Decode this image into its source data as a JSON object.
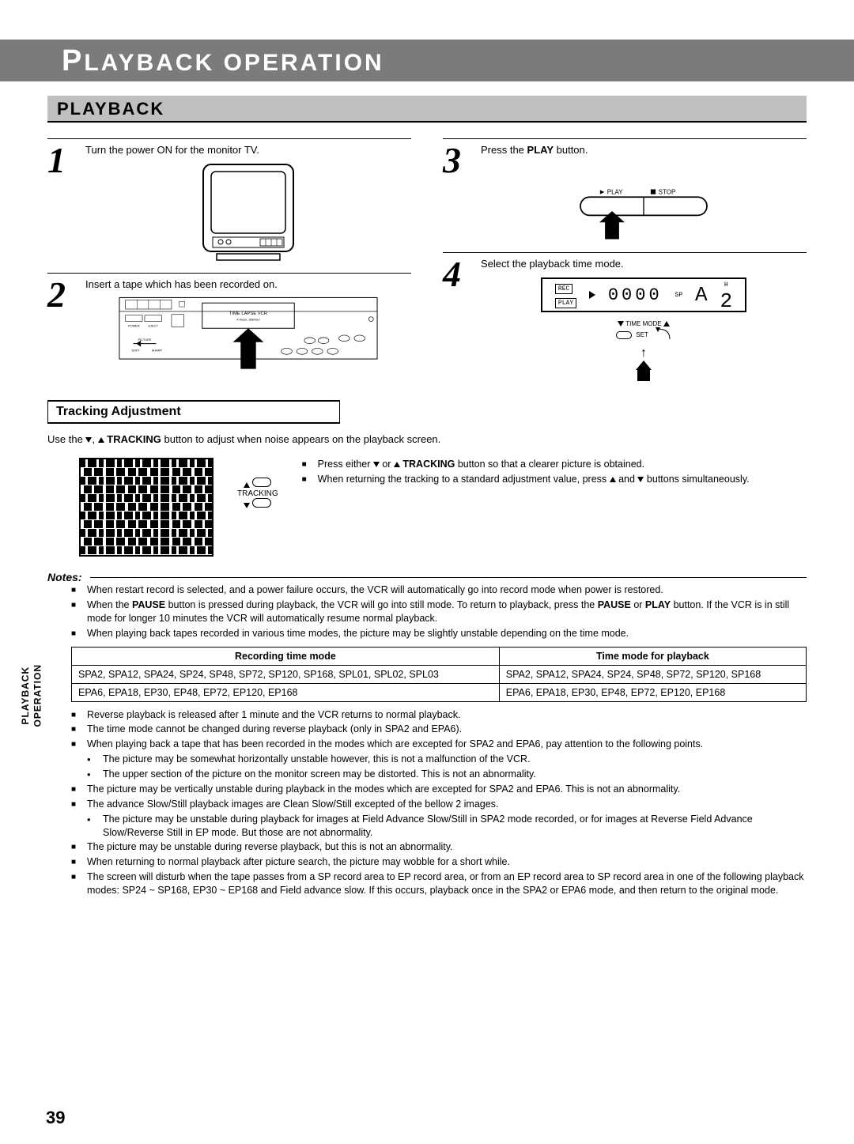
{
  "chapter_title": "LAYBACK OPERATION",
  "chapter_initial": "P",
  "section_title": "PLAYBACK",
  "side_tab_line1": "PLAYBACK",
  "side_tab_line2": "OPERATION",
  "page_number": "39",
  "steps": {
    "s1": "Turn the power ON for the monitor TV.",
    "s2": "Insert a tape which has been recorded on.",
    "s3_pre": "Press the ",
    "s3_bold": "PLAY",
    "s3_post": " button.",
    "s4": "Select the playback time mode."
  },
  "diagrams": {
    "play_label": "PLAY",
    "stop_label": "STOP",
    "vcr_label": "TIME LAPSE VCR",
    "vcr_sub": "4-Head, 168Hour",
    "tracking_label": "TRACKING",
    "time_mode_label": "TIME MODE",
    "set_label": "SET",
    "lcd_rec": "REC",
    "lcd_play": "PLAY",
    "lcd_digits": "0000",
    "lcd_mode": "SP",
    "lcd_A": "A",
    "lcd_H": "H",
    "lcd_2": "2"
  },
  "tracking_subtitle": "Tracking Adjustment",
  "tracking_intro_pre": "Use the ",
  "tracking_intro_mid": " TRACKING",
  "tracking_intro_post": " button to adjust when noise appears on the playback screen.",
  "tracking_bullets": {
    "b1_pre": "Press either ",
    "b1_mid": " TRACKING",
    "b1_post": " button so that a clearer picture is obtained.",
    "b2_pre": "When returning the tracking to a standard adjustment value, press ",
    "b2_mid": " and ",
    "b2_post": " buttons simultaneously."
  },
  "notes_header": "Notes:",
  "notes_a": {
    "n1": "When restart record is selected, and a power failure occurs, the VCR will automatically go into record mode when power is restored.",
    "n2_a": "When the ",
    "n2_b": "PAUSE",
    "n2_c": " button is pressed during playback, the VCR will go into still mode. To return to playback, press the ",
    "n2_d": "PAUSE",
    "n2_e": " or ",
    "n2_f": "PLAY",
    "n2_g": " button. If the VCR is in still mode for longer 10 minutes the VCR will automatically resume normal playback.",
    "n3": "When playing back tapes recorded in various time modes, the picture may be slightly unstable depending on the time mode."
  },
  "table": {
    "h1": "Recording time mode",
    "h2": "Time mode for playback",
    "r1c1": "SPA2, SPA12, SPA24, SP24, SP48, SP72, SP120, SP168, SPL01, SPL02, SPL03",
    "r1c2": "SPA2, SPA12, SPA24, SP24, SP48, SP72, SP120, SP168",
    "r2c1": "EPA6, EPA18, EP30, EP48, EP72, EP120, EP168",
    "r2c2": "EPA6, EPA18, EP30, EP48, EP72, EP120, EP168"
  },
  "notes_b": {
    "n4": "Reverse playback is released after 1 minute and the VCR returns to normal playback.",
    "n5": "The time mode cannot be changed during reverse playback (only in SPA2 and EPA6).",
    "n6": "When playing back a tape that has been recorded in the modes which are excepted for SPA2 and EPA6, pay attention to the following points.",
    "n6a": "The picture may be somewhat horizontally unstable however, this is not a malfunction of the VCR.",
    "n6b": "The upper section of the picture on the monitor screen may be distorted. This is not an abnormality.",
    "n7": "The picture may be vertically unstable during playback in the modes which are excepted for SPA2 and EPA6. This is not an abnormality.",
    "n8": "The advance Slow/Still playback images are Clean Slow/Still excepted of the bellow 2 images.",
    "n8a": "The picture may be unstable during playback for images at Field Advance Slow/Still in SPA2 mode recorded, or for images at Reverse Field Advance Slow/Reverse Still in EP mode. But those are not abnormality.",
    "n9": "The picture may be unstable during reverse playback, but this is not an abnormality.",
    "n10": "When returning to normal playback after picture search, the picture may wobble for a short while.",
    "n11": "The screen will disturb when the tape passes from a SP record area to EP record area, or from an EP record area to SP record area in one of the following playback modes: SP24 ~ SP168, EP30 ~ EP168 and Field advance slow. If this occurs, playback once in the SPA2 or EPA6 mode, and then return to the original mode."
  }
}
